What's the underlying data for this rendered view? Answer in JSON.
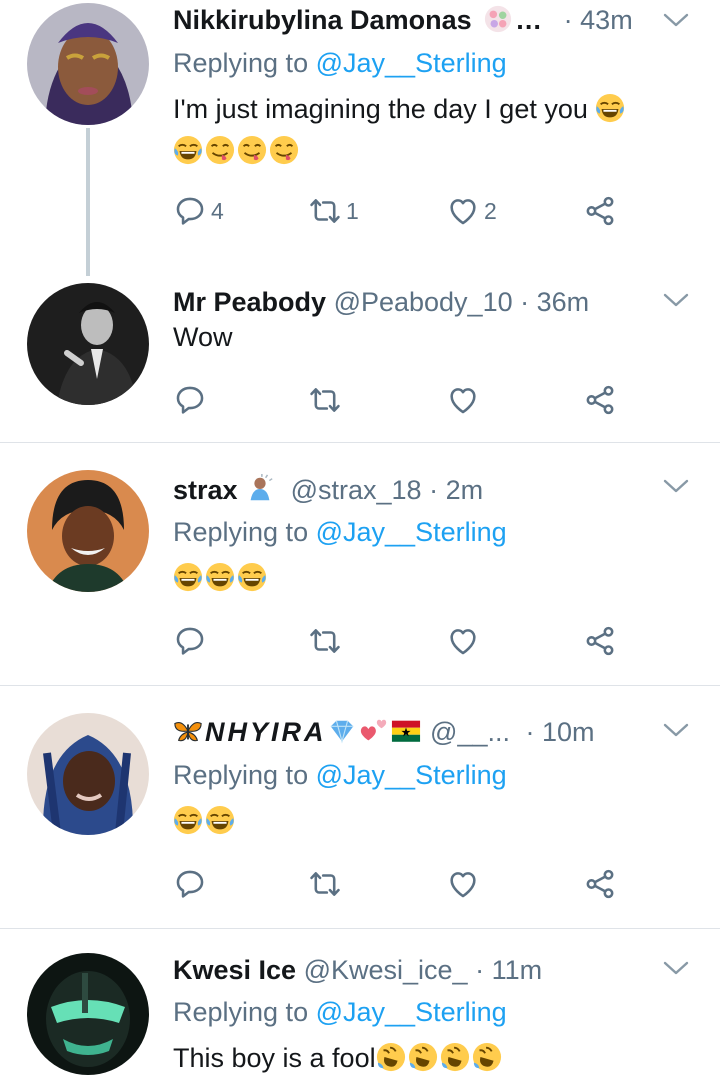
{
  "tweets": [
    {
      "name": "Nikkirubylina Damonas",
      "name_suffix": "…",
      "handle": "",
      "time": "43m",
      "replying_prefix": "Replying to",
      "replying_to": "@Jay__Sterling",
      "text": "I'm just imagining the day I get you",
      "emojis": [
        "joy-emoji",
        "yum-emoji",
        "yum-emoji",
        "yum-emoji"
      ],
      "reply_count": "4",
      "retweet_count": "1",
      "like_count": "2"
    },
    {
      "name": "Mr Peabody",
      "handle": "@Peabody_10",
      "time": "36m",
      "text": "Wow"
    },
    {
      "name": "strax",
      "handle": "@strax_18",
      "time": "2m",
      "replying_prefix": "Replying to",
      "replying_to": "@Jay__Sterling",
      "text": "",
      "emojis": [
        "joy-emoji",
        "joy-emoji",
        "joy-emoji"
      ]
    },
    {
      "name": "NHYIRA",
      "handle": "@__...",
      "time": "10m",
      "replying_prefix": "Replying to",
      "replying_to": "@Jay__Sterling",
      "text": "",
      "emojis": [
        "joy-emoji",
        "joy-emoji"
      ]
    },
    {
      "name": "Kwesi Ice",
      "handle": "@Kwesi_ice_",
      "time": "11m",
      "replying_prefix": "Replying to",
      "replying_to": "@Jay__Sterling",
      "text": "This boy is a fool",
      "emojis": [
        "rofl-emoji",
        "rofl-emoji",
        "rofl-emoji",
        "rofl-emoji"
      ]
    }
  ],
  "separator_dot": "·",
  "colors": {
    "secondary": "#5b7083",
    "link": "#1da1f2",
    "text": "#14171a",
    "divider": "#dfe3e8",
    "thread": "#c4cfd6"
  }
}
